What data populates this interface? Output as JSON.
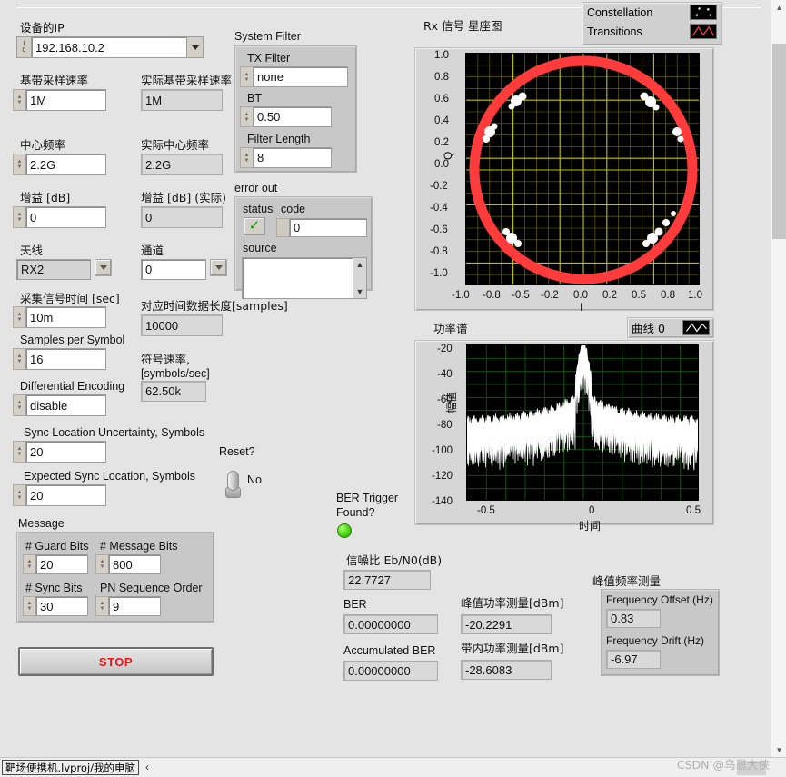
{
  "device": {
    "ip_label": "设备的IP",
    "ip_value": "192.168.10.2",
    "baseband_rate_label": "基带采样速率",
    "baseband_rate_value": "1M",
    "actual_baseband_rate_label": "实际基带采样速率",
    "actual_baseband_rate_value": "1M",
    "center_freq_label": "中心频率",
    "center_freq_value": "2.2G",
    "actual_center_freq_label": "实际中心频率",
    "actual_center_freq_value": "2.2G",
    "gain_label": "增益 [dB]",
    "gain_value": "0",
    "actual_gain_label": "增益 [dB] (实际)",
    "actual_gain_value": "0",
    "antenna_label": "天线",
    "antenna_value": "RX2",
    "channel_label": "通道",
    "channel_value": "0",
    "acq_time_label": "采集信号时间 [sec]",
    "acq_time_value": "10m",
    "data_length_label": "对应时间数据长度[samples]",
    "data_length_value": "10000",
    "samples_per_symbol_label": "Samples per Symbol",
    "samples_per_symbol_value": "16",
    "symbol_rate_label_line1": "符号速率,",
    "symbol_rate_label_line2": "[symbols/sec]",
    "symbol_rate_value": "62.50k",
    "diff_encoding_label": "Differential Encoding",
    "diff_encoding_value": "disable",
    "sync_uncertainty_label": "Sync Location Uncertainty, Symbols",
    "sync_uncertainty_value": "20",
    "expected_sync_label": "Expected Sync Location, Symbols",
    "expected_sync_value": "20"
  },
  "reset": {
    "label": "Reset?",
    "state": "No"
  },
  "message": {
    "title": "Message",
    "guard_bits_label": "# Guard Bits",
    "guard_bits_value": "20",
    "message_bits_label": "# Message Bits",
    "message_bits_value": "800",
    "sync_bits_label": "# Sync Bits",
    "sync_bits_value": "30",
    "pn_order_label": "PN Sequence Order",
    "pn_order_value": "9"
  },
  "system_filter": {
    "title": "System Filter",
    "tx_filter_label": "TX Filter",
    "tx_filter_value": "none",
    "bt_label": "BT",
    "bt_value": "0.50",
    "filter_length_label": "Filter Length",
    "filter_length_value": "8"
  },
  "error_out": {
    "title": "error out",
    "status_label": "status",
    "code_label": "code",
    "code_value": "0",
    "source_label": "source",
    "source_value": ""
  },
  "ber": {
    "trigger_label_line1": "BER Trigger",
    "trigger_label_line2": "Found?",
    "ebn0_label": "信噪比 Eb/N0(dB)",
    "ebn0_value": "22.7727",
    "ber_label": "BER",
    "ber_value": "0.00000000",
    "acc_ber_label": "Accumulated BER",
    "acc_ber_value": "0.00000000",
    "peak_power_label": "峰值功率测量[dBm]",
    "peak_power_value": "-20.2291",
    "inband_power_label": "带内功率测量[dBm]",
    "inband_power_value": "-28.6083"
  },
  "freq_meas": {
    "title": "峰值频率测量",
    "offset_label": "Frequency Offset (Hz)",
    "offset_value": "0.83",
    "drift_label": "Frequency Drift (Hz)",
    "drift_value": "-6.97"
  },
  "stop_button": {
    "label": "STOP"
  },
  "statusbar": {
    "path": "靶场便携机.lvproj/我的电脑",
    "chevron": "‹"
  },
  "watermark": "CSDN @乌恩大侠",
  "chart_data": [
    {
      "type": "scatter",
      "name": "constellation",
      "title": "Rx 信号 星座图",
      "xlabel": "I",
      "ylabel": "Q",
      "xlim": [
        -1.0,
        1.0
      ],
      "ylim": [
        -1.0,
        1.0
      ],
      "xticks": [
        "-1.0",
        "-0.8",
        "-0.5",
        "-0.2",
        "0.0",
        "0.2",
        "0.5",
        "0.8",
        "1.0"
      ],
      "yticks": [
        "1.0",
        "0.8",
        "0.6",
        "0.4",
        "0.2",
        "0.0",
        "-0.2",
        "-0.4",
        "-0.6",
        "-0.8",
        "-1.0"
      ],
      "grid": true,
      "grid_color": "#b4b400",
      "background": "#000000",
      "trace_color": "#ff3b3b",
      "marker_color": "#ffffff",
      "description": "Dense red ring of radius ~0.97 with white symbol clusters",
      "ring_radius": 0.97,
      "ring_width": 0.09,
      "clusters_deg": [
        128,
        151,
        31,
        52,
        211,
        231,
        310,
        330
      ],
      "legend": [
        {
          "label": "Constellation",
          "glyph": "dots"
        },
        {
          "label": "Transitions",
          "glyph": "zigzag"
        }
      ]
    },
    {
      "type": "line",
      "name": "power-spectrum",
      "title": "功率谱",
      "xlabel": "时间",
      "ylabel": "幅值",
      "xlim": [
        -0.5,
        0.5
      ],
      "ylim": [
        -140,
        -20
      ],
      "xticks": [
        "-0.5",
        "0",
        "0.5"
      ],
      "yticks": [
        "-20",
        "-40",
        "-60",
        "-80",
        "-100",
        "-120",
        "-140"
      ],
      "grid": true,
      "grid_color": "#0d5a0d",
      "background": "#000000",
      "trace_color": "#ffffff",
      "peak_db": -21,
      "noise_floor_db": -85,
      "legend": [
        {
          "label": "曲线 0",
          "glyph": "zigzag"
        }
      ]
    }
  ]
}
